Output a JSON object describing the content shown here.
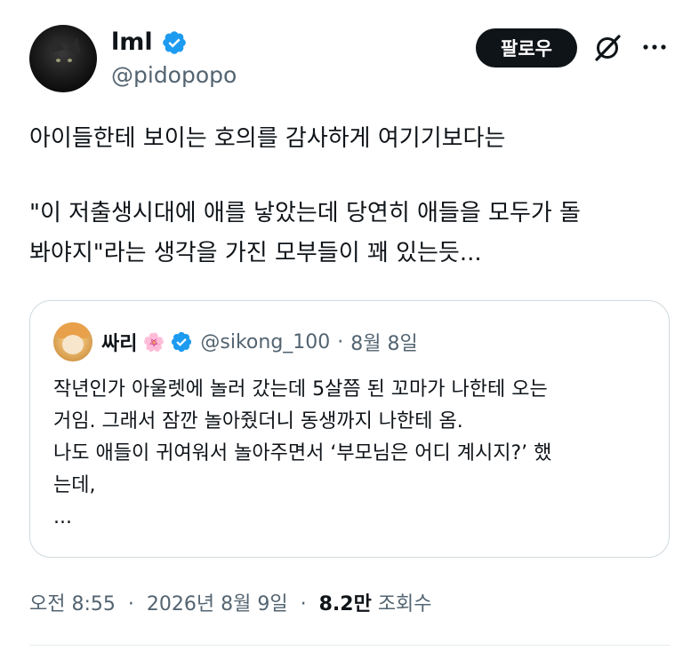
{
  "author": {
    "display_name": "lml",
    "handle": "@pidopopo",
    "verified": true
  },
  "follow_button_label": "팔로우",
  "icons": {
    "grok": "grok-slash-icon",
    "more": "more-horizontal-icon",
    "verified": "verified-badge-icon",
    "quote_flower": "cherry-blossom-icon"
  },
  "colors": {
    "verified_blue": "#1d9bf0",
    "text_primary": "#0f1419",
    "text_secondary": "#536471",
    "border": "#cfd9de"
  },
  "tweet": {
    "line1": "아이들한테 보이는 호의를 감사하게 여기기보다는",
    "line2": "\"이 저출생시대에 애를 낳았는데 당연히 애들을 모두가 돌",
    "line3": "봐야지\"라는 생각을 가진 모부들이 꽤 있는듯..."
  },
  "quote": {
    "name": "싸리",
    "flower": "🌸",
    "handle": "@sikong_100",
    "separator": "·",
    "date": "8월 8일",
    "lines": [
      "작년인가 아울렛에 놀러 갔는데 5살쯤 된 꼬마가 나한테 오는",
      "거임. 그래서 잠깐 놀아줬더니 동생까지 나한테 옴.",
      "나도 애들이 귀여워서 놀아주면서 ‘부모님은 어디 계시지?’ 했",
      "는데,",
      "..."
    ]
  },
  "meta": {
    "time": "오전 8:55",
    "separator": "·",
    "date": "2026년 8월 9일",
    "views_count": "8.2만",
    "views_label": "조회수"
  }
}
